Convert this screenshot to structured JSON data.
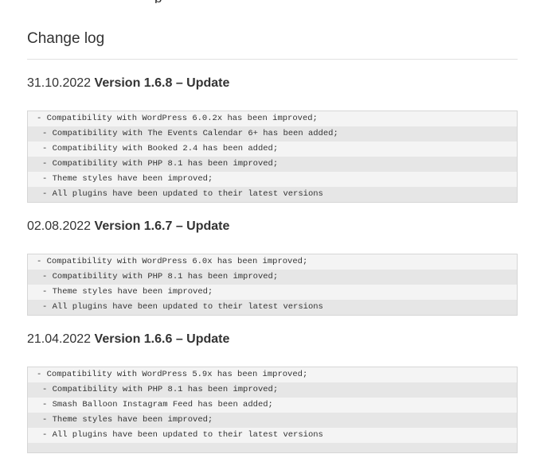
{
  "top_clipped_text": "p",
  "changelog": {
    "heading": "Change log",
    "versions": [
      {
        "date": "31.10.2022",
        "title": "Version 1.6.8 – Update",
        "entries": [
          "- Compatibility with WordPress 6.0.2x has been improved;",
          "- Compatibility with The Events Calendar 6+ has been added;",
          "- Compatibility with Booked 2.4 has been added;",
          "- Compatibility with PHP 8.1 has been improved;",
          "- Theme styles have been improved;",
          "- All plugins have been updated to their latest versions"
        ]
      },
      {
        "date": "02.08.2022",
        "title": "Version 1.6.7 – Update",
        "entries": [
          "- Compatibility with WordPress 6.0x has been improved;",
          "- Compatibility with PHP 8.1 has been improved;",
          "- Theme styles have been improved;",
          "- All plugins have been updated to their latest versions"
        ]
      },
      {
        "date": "21.04.2022",
        "title": "Version 1.6.6 – Update",
        "entries": [
          "- Compatibility with WordPress 5.9x has been improved;",
          "- Compatibility with PHP 8.1 has been improved;",
          "- Smash Balloon Instagram Feed has been added;",
          "- Theme styles have been improved;",
          "- All plugins have been updated to their latest versions"
        ]
      }
    ]
  }
}
